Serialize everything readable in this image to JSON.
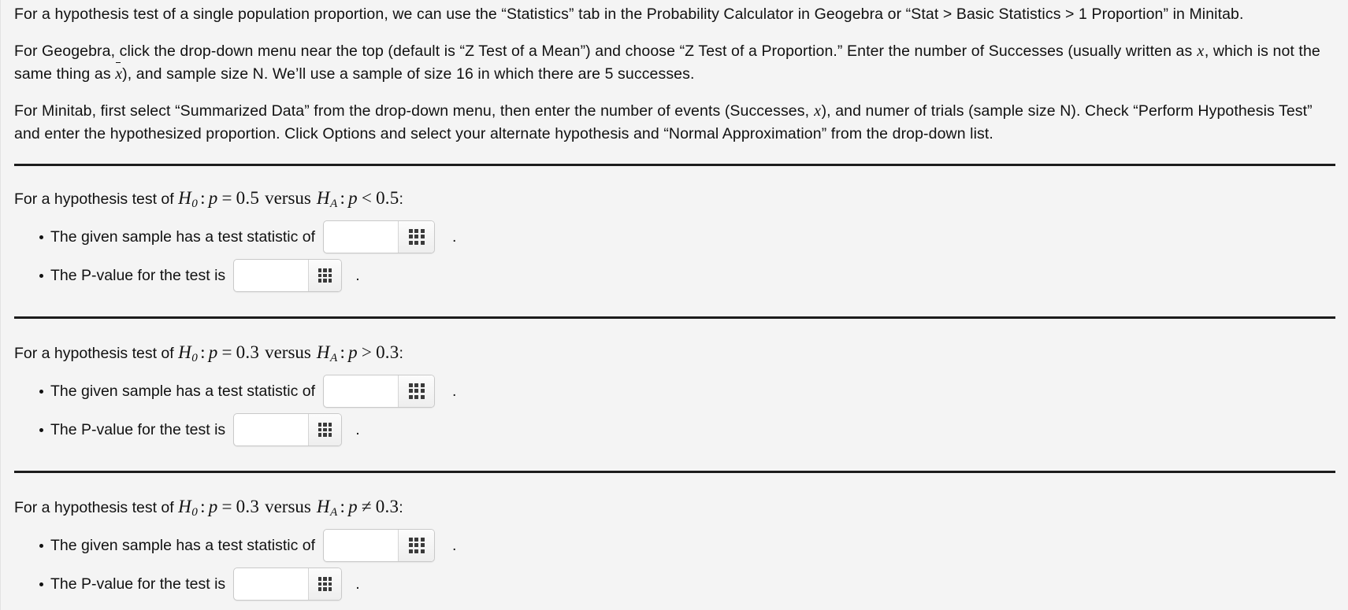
{
  "colors": {
    "background": "#f4f4f4",
    "text": "#111111",
    "rule": "#1c1c1c",
    "input_border": "#c9c9c9",
    "button_face": "#eeeeee",
    "grid_dot": "#3a3a3a"
  },
  "intro": {
    "paragraph_1": "For a hypothesis test of a single population proportion, we can use the “Statistics” tab in the Probability Calculator in Geogebra or “Stat > Basic Statistics > 1 Proportion” in Minitab.",
    "paragraph_2_part_1": "For Geogebra, click the drop-down menu near the top (default is “Z Test of a Mean”) and choose “Z Test of a Proportion.” Enter the number of Successes (usually written as ",
    "paragraph_2_math_1": "x",
    "paragraph_2_part_2": ", which is not the same thing as ",
    "paragraph_2_math_2": "x",
    "paragraph_2_part_3": "), and sample size N. We’ll use a sample of size 16 in which there are 5 successes.",
    "paragraph_3_part_1": "For Minitab, first select “Summarized Data” from the drop-down menu, then enter the number of events (Successes, ",
    "paragraph_3_math_1": "x",
    "paragraph_3_part_2": "), and numer of trials (sample size N). Check “Perform Hypothesis Test” and enter the hypothesized proportion. Click Options and select your alternate hypothesis and “Normal Approximation” from the drop-down list."
  },
  "sections": [
    {
      "lead": "For a hypothesis test of ",
      "null_symbol": "H",
      "null_subscript": "0",
      "colon": ":",
      "parameter": "p",
      "null_relation": "=",
      "null_value": "0.5",
      "versus": "versus",
      "alt_symbol": "H",
      "alt_subscript": "A",
      "alt_relation": "<",
      "alt_value": "0.5",
      "trailing_colon": ":",
      "answers": [
        {
          "label": "The given sample has a test statistic of",
          "value": "",
          "placeholder": "",
          "button_icon": "grid-icon",
          "terminator": "."
        },
        {
          "label": "The P-value for the test is",
          "value": "",
          "placeholder": "",
          "button_icon": "grid-icon",
          "terminator": "."
        }
      ]
    },
    {
      "lead": "For a hypothesis test of ",
      "null_symbol": "H",
      "null_subscript": "0",
      "colon": ":",
      "parameter": "p",
      "null_relation": "=",
      "null_value": "0.3",
      "versus": "versus",
      "alt_symbol": "H",
      "alt_subscript": "A",
      "alt_relation": ">",
      "alt_value": "0.3",
      "trailing_colon": ":",
      "answers": [
        {
          "label": "The given sample has a test statistic of",
          "value": "",
          "placeholder": "",
          "button_icon": "grid-icon",
          "terminator": "."
        },
        {
          "label": "The P-value for the test is",
          "value": "",
          "placeholder": "",
          "button_icon": "grid-icon",
          "terminator": "."
        }
      ]
    },
    {
      "lead": "For a hypothesis test of ",
      "null_symbol": "H",
      "null_subscript": "0",
      "colon": ":",
      "parameter": "p",
      "null_relation": "=",
      "null_value": "0.3",
      "versus": "versus",
      "alt_symbol": "H",
      "alt_subscript": "A",
      "alt_relation": "≠",
      "alt_value": "0.3",
      "trailing_colon": ":",
      "answers": [
        {
          "label": "The given sample has a test statistic of",
          "value": "",
          "placeholder": "",
          "button_icon": "grid-icon",
          "terminator": "."
        },
        {
          "label": "The P-value for the test is",
          "value": "",
          "placeholder": "",
          "button_icon": "grid-icon",
          "terminator": "."
        }
      ]
    }
  ]
}
